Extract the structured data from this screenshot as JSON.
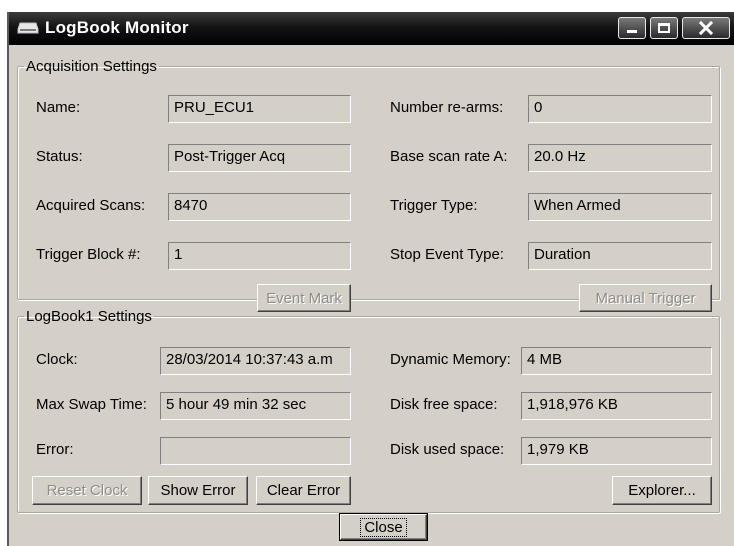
{
  "window": {
    "title": "LogBook Monitor",
    "icon": "drive-icon",
    "controls": [
      "minimize-icon",
      "maximize-icon",
      "close-icon"
    ]
  },
  "acquisition": {
    "legend": "Acquisition Settings",
    "name_label": "Name:",
    "name_value": "PRU_ECU1",
    "status_label": "Status:",
    "status_value": "Post-Trigger Acq",
    "scans_label": "Acquired Scans:",
    "scans_value": "8470",
    "trigger_block_label": "Trigger Block #:",
    "trigger_block_value": "1",
    "rearms_label": "Number re-arms:",
    "rearms_value": "0",
    "scan_rate_label": "Base scan rate A:",
    "scan_rate_value": "20.0 Hz",
    "trigger_type_label": "Trigger Type:",
    "trigger_type_value": "When Armed",
    "stop_event_label": "Stop Event Type:",
    "stop_event_value": "Duration",
    "event_mark_button": "Event Mark",
    "manual_trigger_button": "Manual Trigger"
  },
  "logbook": {
    "legend": "LogBook1 Settings",
    "clock_label": "Clock:",
    "clock_value": "28/03/2014  10:37:43 a.m",
    "swap_label": "Max Swap Time:",
    "swap_value": "5 hour  49 min  32 sec",
    "error_label": "Error:",
    "error_value": "",
    "memory_label": "Dynamic Memory:",
    "memory_value": "4 MB",
    "disk_free_label": "Disk free space:",
    "disk_free_value": "1,918,976 KB",
    "disk_used_label": "Disk used space:",
    "disk_used_value": "1,979 KB",
    "reset_clock_button": "Reset Clock",
    "show_error_button": "Show Error",
    "clear_error_button": "Clear Error",
    "explorer_button": "Explorer..."
  },
  "footer": {
    "close_button": "Close"
  }
}
